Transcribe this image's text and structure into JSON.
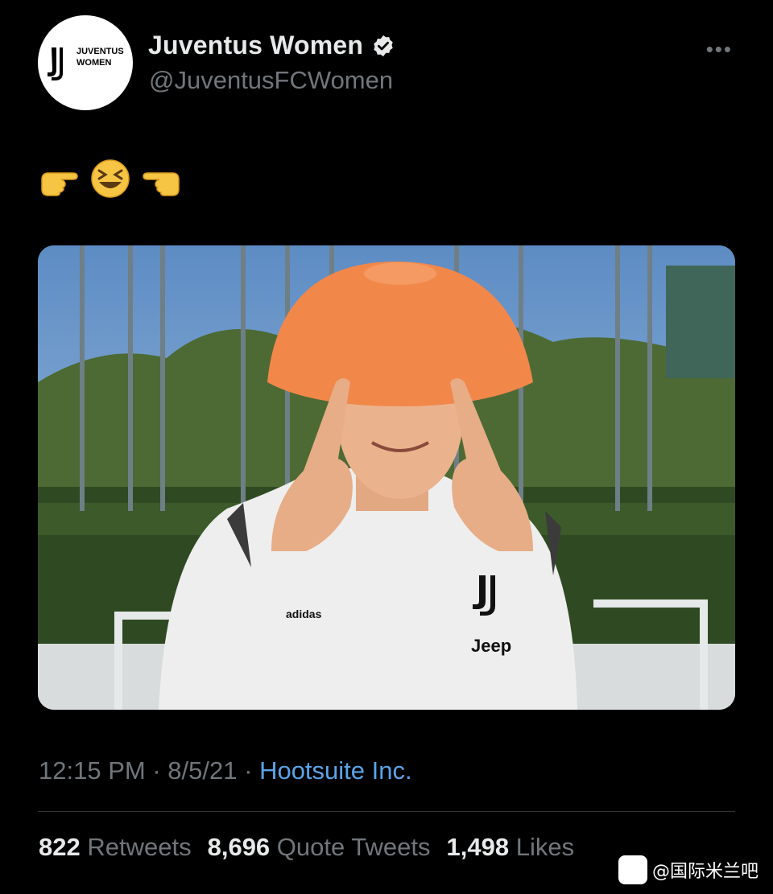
{
  "account": {
    "display_name": "Juventus Women",
    "handle": "@JuventusFCWomen",
    "avatar_text_line1": "JUVENTUS",
    "avatar_text_line2": "WOMEN"
  },
  "tweet": {
    "emojis": [
      "point-right-icon",
      "laughing-face-icon",
      "point-left-icon"
    ],
    "media": {
      "shirt_text_brand": "adidas",
      "shirt_text_sponsor": "Jeep"
    },
    "time": "12:15 PM",
    "date": "8/5/21",
    "separator": "·",
    "source": "Hootsuite Inc."
  },
  "stats": {
    "retweets_count": "822",
    "retweets_label": "Retweets",
    "quotes_count": "8,696",
    "quotes_label": "Quote Tweets",
    "likes_count": "1,498",
    "likes_label": "Likes"
  },
  "watermark": {
    "text": "@国际米兰吧"
  },
  "colors": {
    "background": "#000000",
    "secondary_text": "#71767b",
    "link": "#5ba4e8",
    "cone": "#f2874a"
  }
}
